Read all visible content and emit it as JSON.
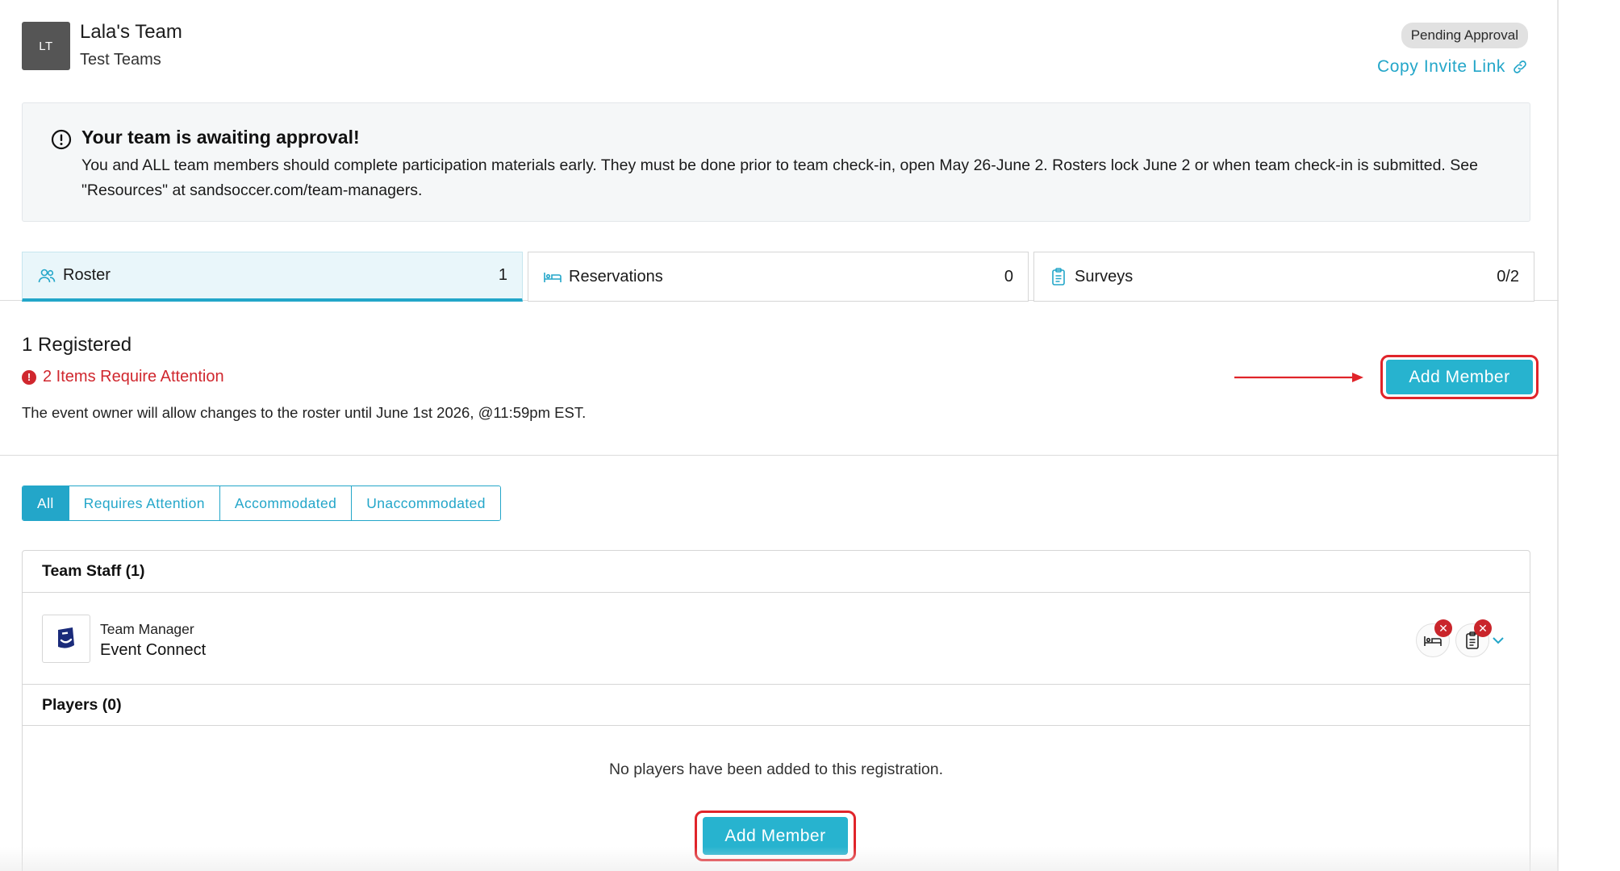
{
  "header": {
    "avatar_initials": "LT",
    "team_name": "Lala's Team",
    "team_subtitle": "Test Teams",
    "status_badge": "Pending Approval",
    "invite_link": "Copy Invite Link"
  },
  "alert": {
    "icon": "exclamation-circle-icon",
    "title": "Your team is awaiting approval!",
    "body": "You and ALL team members should complete participation materials early. They must be done prior to team check-in, open May 26-June 2. Rosters lock June 2 or when team check-in is submitted. See \"Resources\" at sandsoccer.com/team-managers."
  },
  "tabs": [
    {
      "label": "Roster",
      "count": "1",
      "icon": "users-icon",
      "active": true
    },
    {
      "label": "Reservations",
      "count": "0",
      "icon": "bed-icon",
      "active": false
    },
    {
      "label": "Surveys",
      "count": "0/2",
      "icon": "clipboard-icon",
      "active": false
    }
  ],
  "summary": {
    "registered": "1 Registered",
    "attention": "2 Items Require Attention",
    "roster_note": "The event owner will allow changes to the roster until June 1st 2026, @11:59pm EST.",
    "add_member": "Add Member"
  },
  "filters": [
    {
      "label": "All",
      "active": true
    },
    {
      "label": "Requires Attention",
      "active": false
    },
    {
      "label": "Accommodated",
      "active": false
    },
    {
      "label": "Unaccommodated",
      "active": false
    }
  ],
  "roster": {
    "staff_heading": "Team Staff (1)",
    "staff": [
      {
        "role": "Team Manager",
        "name": "Event Connect"
      }
    ],
    "players_heading": "Players (0)",
    "empty_message": "No players have been added to this registration.",
    "add_member": "Add Member"
  },
  "colors": {
    "accent": "#23a6c9",
    "button": "#27b3cf",
    "danger": "#d0272e",
    "badge_bg": "#e1e1e1"
  }
}
